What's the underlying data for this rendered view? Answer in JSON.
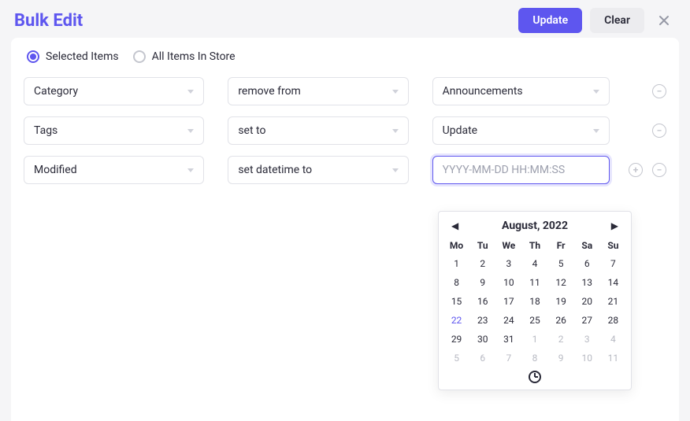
{
  "header": {
    "title": "Bulk Edit",
    "update_label": "Update",
    "clear_label": "Clear"
  },
  "scope": {
    "selected_label": "Selected Items",
    "all_label": "All Items In Store",
    "selected": "selected"
  },
  "rules": [
    {
      "field": "Category",
      "op": "remove from",
      "value": "Announcements",
      "value_kind": "select"
    },
    {
      "field": "Tags",
      "op": "set to",
      "value": "Update",
      "value_kind": "select"
    },
    {
      "field": "Modified",
      "op": "set datetime to",
      "value": "",
      "value_kind": "datetime",
      "placeholder": "YYYY-MM-DD HH:MM:SS"
    }
  ],
  "datepicker": {
    "title": "August, 2022",
    "dows": [
      "Mo",
      "Tu",
      "We",
      "Th",
      "Fr",
      "Sa",
      "Su"
    ],
    "weeks": [
      [
        {
          "d": "1"
        },
        {
          "d": "2"
        },
        {
          "d": "3"
        },
        {
          "d": "4"
        },
        {
          "d": "5"
        },
        {
          "d": "6"
        },
        {
          "d": "7"
        }
      ],
      [
        {
          "d": "8"
        },
        {
          "d": "9"
        },
        {
          "d": "10"
        },
        {
          "d": "11"
        },
        {
          "d": "12"
        },
        {
          "d": "13"
        },
        {
          "d": "14"
        }
      ],
      [
        {
          "d": "15"
        },
        {
          "d": "16"
        },
        {
          "d": "17"
        },
        {
          "d": "18"
        },
        {
          "d": "19"
        },
        {
          "d": "20"
        },
        {
          "d": "21"
        }
      ],
      [
        {
          "d": "22",
          "today": true
        },
        {
          "d": "23"
        },
        {
          "d": "24"
        },
        {
          "d": "25"
        },
        {
          "d": "26"
        },
        {
          "d": "27"
        },
        {
          "d": "28"
        }
      ],
      [
        {
          "d": "29"
        },
        {
          "d": "30"
        },
        {
          "d": "31"
        },
        {
          "d": "1",
          "other": true
        },
        {
          "d": "2",
          "other": true
        },
        {
          "d": "3",
          "other": true
        },
        {
          "d": "4",
          "other": true
        }
      ],
      [
        {
          "d": "5",
          "other": true
        },
        {
          "d": "6",
          "other": true
        },
        {
          "d": "7",
          "other": true
        },
        {
          "d": "8",
          "other": true
        },
        {
          "d": "9",
          "other": true
        },
        {
          "d": "10",
          "other": true
        },
        {
          "d": "11",
          "other": true
        }
      ]
    ]
  }
}
